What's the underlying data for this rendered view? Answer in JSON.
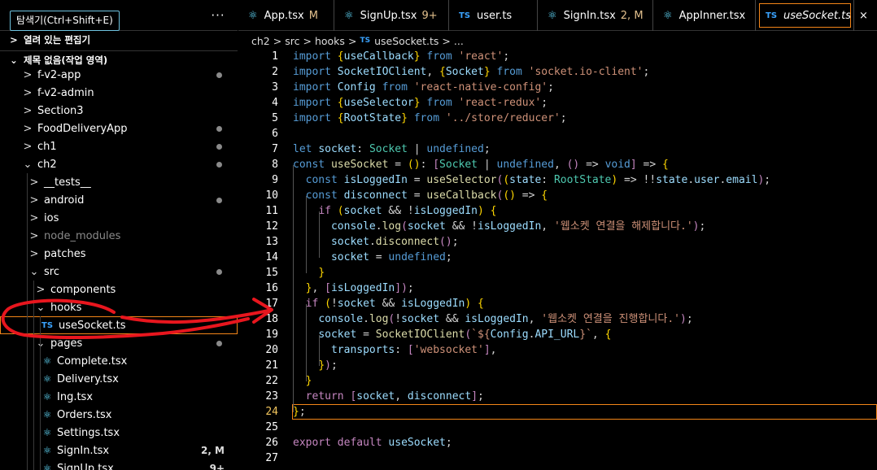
{
  "explorer": {
    "tooltip": "탐색기(Ctrl+Shift+E)",
    "more": "···",
    "open_editors": "열려 있는 편집기",
    "workspace": "제목 없음(작업 영역)",
    "items": [
      {
        "label": "f-v2-app",
        "kind": "folder",
        "open": false,
        "depth": 0,
        "dot": true
      },
      {
        "label": "f-v2-admin",
        "kind": "folder",
        "open": false,
        "depth": 0,
        "dot": false
      },
      {
        "label": "Section3",
        "kind": "folder",
        "open": false,
        "depth": 0,
        "dot": false
      },
      {
        "label": "FoodDeliveryApp",
        "kind": "folder",
        "open": false,
        "depth": 0,
        "dot": true
      },
      {
        "label": "ch1",
        "kind": "folder",
        "open": false,
        "depth": 0,
        "dot": true
      },
      {
        "label": "ch2",
        "kind": "folder",
        "open": true,
        "depth": 0,
        "dot": true
      },
      {
        "label": "__tests__",
        "kind": "folder",
        "open": false,
        "depth": 1,
        "dot": false
      },
      {
        "label": "android",
        "kind": "folder",
        "open": false,
        "depth": 1,
        "dot": true
      },
      {
        "label": "ios",
        "kind": "folder",
        "open": false,
        "depth": 1,
        "dot": false
      },
      {
        "label": "node_modules",
        "kind": "folder",
        "open": false,
        "depth": 1,
        "dot": false,
        "dim": true
      },
      {
        "label": "patches",
        "kind": "folder",
        "open": false,
        "depth": 1,
        "dot": false
      },
      {
        "label": "src",
        "kind": "folder",
        "open": true,
        "depth": 1,
        "dot": true
      },
      {
        "label": "components",
        "kind": "folder",
        "open": false,
        "depth": 2,
        "dot": false
      },
      {
        "label": "hooks",
        "kind": "folder",
        "open": true,
        "depth": 2,
        "dot": false
      },
      {
        "label": "useSocket.ts",
        "kind": "ts",
        "depth": 3,
        "dot": false,
        "selected": true
      },
      {
        "label": "pages",
        "kind": "folder",
        "open": true,
        "depth": 2,
        "dot": true
      },
      {
        "label": "Complete.tsx",
        "kind": "react",
        "depth": 3,
        "dot": false
      },
      {
        "label": "Delivery.tsx",
        "kind": "react",
        "depth": 3,
        "dot": false
      },
      {
        "label": "Ing.tsx",
        "kind": "react",
        "depth": 3,
        "dot": false
      },
      {
        "label": "Orders.tsx",
        "kind": "react",
        "depth": 3,
        "dot": false
      },
      {
        "label": "Settings.tsx",
        "kind": "react",
        "depth": 3,
        "dot": false
      },
      {
        "label": "SignIn.tsx",
        "kind": "react",
        "depth": 3,
        "dot": false,
        "badge": "2, M"
      },
      {
        "label": "SignUp.tsx",
        "kind": "react",
        "depth": 3,
        "dot": false,
        "badge": "9+"
      }
    ]
  },
  "tabs": [
    {
      "label": "App.tsx",
      "kind": "react",
      "status": "M"
    },
    {
      "label": "SignUp.tsx",
      "kind": "react",
      "status": "9+"
    },
    {
      "label": "user.ts",
      "kind": "ts",
      "status": ""
    },
    {
      "label": "SignIn.tsx",
      "kind": "react",
      "status": "2, M"
    },
    {
      "label": "AppInner.tsx",
      "kind": "react",
      "status": ""
    },
    {
      "label": "useSocket.ts",
      "kind": "ts",
      "status": "",
      "active": true,
      "close": "×"
    }
  ],
  "breadcrumb": [
    "ch2",
    "src",
    "hooks",
    "useSocket.ts",
    "..."
  ],
  "icons": {
    "ts": "TS",
    "react": "⚛",
    "chevron_right": ">",
    "chevron_down": "⌄"
  },
  "editor": {
    "current_line": 24,
    "lines": [
      [
        [
          "k",
          "import "
        ],
        [
          "br",
          "{"
        ],
        [
          "v",
          "useCallback"
        ],
        [
          "br",
          "}"
        ],
        [
          "k",
          " from "
        ],
        [
          "s",
          "'react'"
        ],
        [
          "p",
          ";"
        ]
      ],
      [
        [
          "k",
          "import "
        ],
        [
          "v",
          "SocketIOClient"
        ],
        [
          "p",
          ", "
        ],
        [
          "br",
          "{"
        ],
        [
          "v",
          "Socket"
        ],
        [
          "br",
          "}"
        ],
        [
          "k",
          " from "
        ],
        [
          "s",
          "'socket.io-client'"
        ],
        [
          "p",
          ";"
        ]
      ],
      [
        [
          "k",
          "import "
        ],
        [
          "v",
          "Config"
        ],
        [
          "k",
          " from "
        ],
        [
          "s",
          "'react-native-config'"
        ],
        [
          "p",
          ";"
        ]
      ],
      [
        [
          "k",
          "import "
        ],
        [
          "br",
          "{"
        ],
        [
          "v",
          "useSelector"
        ],
        [
          "br",
          "}"
        ],
        [
          "k",
          " from "
        ],
        [
          "s",
          "'react-redux'"
        ],
        [
          "p",
          ";"
        ]
      ],
      [
        [
          "k",
          "import "
        ],
        [
          "br",
          "{"
        ],
        [
          "v",
          "RootState"
        ],
        [
          "br",
          "}"
        ],
        [
          "k",
          " from "
        ],
        [
          "s",
          "'../store/reducer'"
        ],
        [
          "p",
          ";"
        ]
      ],
      [],
      [
        [
          "k",
          "let "
        ],
        [
          "v",
          "socket"
        ],
        [
          "p",
          ": "
        ],
        [
          "t",
          "Socket"
        ],
        [
          "p",
          " | "
        ],
        [
          "k",
          "undefined"
        ],
        [
          "p",
          ";"
        ]
      ],
      [
        [
          "k",
          "const "
        ],
        [
          "f",
          "useSocket"
        ],
        [
          "p",
          " = "
        ],
        [
          "br",
          "()"
        ],
        [
          "p",
          ": "
        ],
        [
          "c",
          "["
        ],
        [
          "t",
          "Socket"
        ],
        [
          "p",
          " | "
        ],
        [
          "k",
          "undefined"
        ],
        [
          "p",
          ", "
        ],
        [
          "c",
          "()"
        ],
        [
          "p",
          " => "
        ],
        [
          "k",
          "void"
        ],
        [
          "c",
          "]"
        ],
        [
          "p",
          " => "
        ],
        [
          "br",
          "{"
        ]
      ],
      [
        [
          "p",
          "  "
        ],
        [
          "k",
          "const "
        ],
        [
          "v",
          "isLoggedIn"
        ],
        [
          "p",
          " = "
        ],
        [
          "f",
          "useSelector"
        ],
        [
          "c",
          "("
        ],
        [
          "br",
          "("
        ],
        [
          "v",
          "state"
        ],
        [
          "p",
          ": "
        ],
        [
          "t",
          "RootState"
        ],
        [
          "br",
          ")"
        ],
        [
          "p",
          " => !!"
        ],
        [
          "v",
          "state"
        ],
        [
          "p",
          "."
        ],
        [
          "v",
          "user"
        ],
        [
          "p",
          "."
        ],
        [
          "v",
          "email"
        ],
        [
          "c",
          ")"
        ],
        [
          "p",
          ";"
        ]
      ],
      [
        [
          "p",
          "  "
        ],
        [
          "k",
          "const "
        ],
        [
          "v",
          "disconnect"
        ],
        [
          "p",
          " = "
        ],
        [
          "f",
          "useCallback"
        ],
        [
          "c",
          "("
        ],
        [
          "br",
          "()"
        ],
        [
          "p",
          " => "
        ],
        [
          "br",
          "{"
        ]
      ],
      [
        [
          "p",
          "    "
        ],
        [
          "c",
          "if "
        ],
        [
          "br",
          "("
        ],
        [
          "v",
          "socket"
        ],
        [
          "p",
          " && !"
        ],
        [
          "v",
          "isLoggedIn"
        ],
        [
          "br",
          ")"
        ],
        [
          "p",
          " "
        ],
        [
          "br",
          "{"
        ]
      ],
      [
        [
          "p",
          "      "
        ],
        [
          "v",
          "console"
        ],
        [
          "p",
          "."
        ],
        [
          "f",
          "log"
        ],
        [
          "c",
          "("
        ],
        [
          "v",
          "socket"
        ],
        [
          "p",
          " && !"
        ],
        [
          "v",
          "isLoggedIn"
        ],
        [
          "p",
          ", "
        ],
        [
          "s",
          "'웹소켓 연결을 해제합니다.'"
        ],
        [
          "c",
          ")"
        ],
        [
          "p",
          ";"
        ]
      ],
      [
        [
          "p",
          "      "
        ],
        [
          "v",
          "socket"
        ],
        [
          "p",
          "."
        ],
        [
          "f",
          "disconnect"
        ],
        [
          "c",
          "()"
        ],
        [
          "p",
          ";"
        ]
      ],
      [
        [
          "p",
          "      "
        ],
        [
          "v",
          "socket"
        ],
        [
          "p",
          " = "
        ],
        [
          "k",
          "undefined"
        ],
        [
          "p",
          ";"
        ]
      ],
      [
        [
          "p",
          "    "
        ],
        [
          "br",
          "}"
        ]
      ],
      [
        [
          "p",
          "  "
        ],
        [
          "br",
          "}"
        ],
        [
          "p",
          ", "
        ],
        [
          "c",
          "["
        ],
        [
          "v",
          "isLoggedIn"
        ],
        [
          "c",
          "]"
        ],
        [
          "c",
          ")"
        ],
        [
          "p",
          ";"
        ]
      ],
      [
        [
          "p",
          "  "
        ],
        [
          "c",
          "if "
        ],
        [
          "br",
          "("
        ],
        [
          "p",
          "!"
        ],
        [
          "v",
          "socket"
        ],
        [
          "p",
          " && "
        ],
        [
          "v",
          "isLoggedIn"
        ],
        [
          "br",
          ")"
        ],
        [
          "p",
          " "
        ],
        [
          "br",
          "{"
        ]
      ],
      [
        [
          "p",
          "    "
        ],
        [
          "v",
          "console"
        ],
        [
          "p",
          "."
        ],
        [
          "f",
          "log"
        ],
        [
          "c",
          "("
        ],
        [
          "p",
          "!"
        ],
        [
          "v",
          "socket"
        ],
        [
          "p",
          " && "
        ],
        [
          "v",
          "isLoggedIn"
        ],
        [
          "p",
          ", "
        ],
        [
          "s",
          "'웹소켓 연결을 진행합니다.'"
        ],
        [
          "c",
          ")"
        ],
        [
          "p",
          ";"
        ]
      ],
      [
        [
          "p",
          "    "
        ],
        [
          "v",
          "socket"
        ],
        [
          "p",
          " = "
        ],
        [
          "f",
          "SocketIOClient"
        ],
        [
          "c",
          "("
        ],
        [
          "s",
          "`${"
        ],
        [
          "v",
          "Config"
        ],
        [
          "p",
          "."
        ],
        [
          "v",
          "API_URL"
        ],
        [
          "s",
          "}`"
        ],
        [
          "p",
          ", "
        ],
        [
          "br",
          "{"
        ]
      ],
      [
        [
          "p",
          "      "
        ],
        [
          "v",
          "transports"
        ],
        [
          "p",
          ": "
        ],
        [
          "c",
          "["
        ],
        [
          "s",
          "'websocket'"
        ],
        [
          "c",
          "]"
        ],
        [
          "p",
          ","
        ]
      ],
      [
        [
          "p",
          "    "
        ],
        [
          "br",
          "}"
        ],
        [
          "c",
          ")"
        ],
        [
          "p",
          ";"
        ]
      ],
      [
        [
          "p",
          "  "
        ],
        [
          "br",
          "}"
        ]
      ],
      [
        [
          "p",
          "  "
        ],
        [
          "c",
          "return "
        ],
        [
          "c",
          "["
        ],
        [
          "v",
          "socket"
        ],
        [
          "p",
          ", "
        ],
        [
          "v",
          "disconnect"
        ],
        [
          "c",
          "]"
        ],
        [
          "p",
          ";"
        ]
      ],
      [
        [
          "br",
          "}"
        ],
        [
          "p",
          ";"
        ]
      ],
      [],
      [
        [
          "c",
          "export "
        ],
        [
          "c",
          "default "
        ],
        [
          "v",
          "useSocket"
        ],
        [
          "p",
          ";"
        ]
      ],
      []
    ]
  }
}
